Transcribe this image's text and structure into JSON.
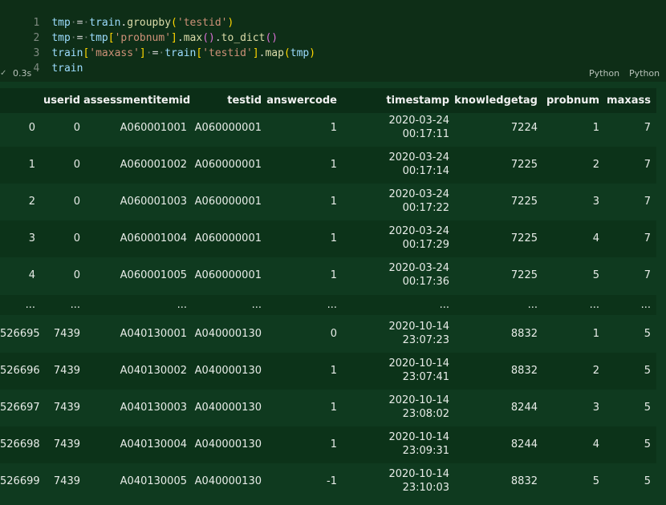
{
  "code": {
    "lines": [
      {
        "n": "1"
      },
      {
        "n": "2"
      },
      {
        "n": "3"
      },
      {
        "n": "4"
      }
    ],
    "tokens": {
      "l1": [
        "tmp",
        "=",
        "train",
        ".",
        "groupby",
        "(",
        "'testid'",
        ")"
      ],
      "l2": [
        "tmp",
        "=",
        "tmp",
        "[",
        "'probnum'",
        "]",
        ".",
        "max",
        "()",
        ".",
        "to_dict",
        "()"
      ],
      "l3": [
        "train",
        "[",
        "'maxass'",
        "]",
        "=",
        "train",
        "[",
        "'testid'",
        "]",
        ".",
        "map",
        "(",
        "tmp",
        ")"
      ],
      "l4": [
        "train"
      ]
    }
  },
  "status": {
    "check": "✓",
    "exec_time": "0.3s",
    "lang_left": "Python",
    "lang_right": "Python"
  },
  "table": {
    "columns": [
      "",
      "userid",
      "assessmentitemid",
      "testid",
      "answercode",
      "timestamp",
      "knowledgetag",
      "probnum",
      "maxass"
    ],
    "rows": [
      {
        "idx": "0",
        "userid": "0",
        "item": "A060001001",
        "testid": "A060000001",
        "answer": "1",
        "date": "2020-03-24",
        "time": "00:17:11",
        "tag": "7224",
        "prob": "1",
        "maxass": "7"
      },
      {
        "idx": "1",
        "userid": "0",
        "item": "A060001002",
        "testid": "A060000001",
        "answer": "1",
        "date": "2020-03-24",
        "time": "00:17:14",
        "tag": "7225",
        "prob": "2",
        "maxass": "7"
      },
      {
        "idx": "2",
        "userid": "0",
        "item": "A060001003",
        "testid": "A060000001",
        "answer": "1",
        "date": "2020-03-24",
        "time": "00:17:22",
        "tag": "7225",
        "prob": "3",
        "maxass": "7"
      },
      {
        "idx": "3",
        "userid": "0",
        "item": "A060001004",
        "testid": "A060000001",
        "answer": "1",
        "date": "2020-03-24",
        "time": "00:17:29",
        "tag": "7225",
        "prob": "4",
        "maxass": "7"
      },
      {
        "idx": "4",
        "userid": "0",
        "item": "A060001005",
        "testid": "A060000001",
        "answer": "1",
        "date": "2020-03-24",
        "time": "00:17:36",
        "tag": "7225",
        "prob": "5",
        "maxass": "7"
      }
    ],
    "ellipsis": "...",
    "rows_tail": [
      {
        "idx": "526695",
        "userid": "7439",
        "item": "A040130001",
        "testid": "A040000130",
        "answer": "0",
        "date": "2020-10-14",
        "time": "23:07:23",
        "tag": "8832",
        "prob": "1",
        "maxass": "5"
      },
      {
        "idx": "526696",
        "userid": "7439",
        "item": "A040130002",
        "testid": "A040000130",
        "answer": "1",
        "date": "2020-10-14",
        "time": "23:07:41",
        "tag": "8832",
        "prob": "2",
        "maxass": "5"
      },
      {
        "idx": "526697",
        "userid": "7439",
        "item": "A040130003",
        "testid": "A040000130",
        "answer": "1",
        "date": "2020-10-14",
        "time": "23:08:02",
        "tag": "8244",
        "prob": "3",
        "maxass": "5"
      },
      {
        "idx": "526698",
        "userid": "7439",
        "item": "A040130004",
        "testid": "A040000130",
        "answer": "1",
        "date": "2020-10-14",
        "time": "23:09:31",
        "tag": "8244",
        "prob": "4",
        "maxass": "5"
      },
      {
        "idx": "526699",
        "userid": "7439",
        "item": "A040130005",
        "testid": "A040000130",
        "answer": "-1",
        "date": "2020-10-14",
        "time": "23:10:03",
        "tag": "8832",
        "prob": "5",
        "maxass": "5"
      }
    ]
  }
}
